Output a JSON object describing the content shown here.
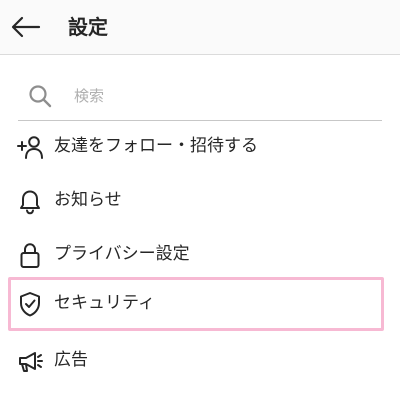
{
  "header": {
    "title": "設定",
    "back_icon": "arrow-left-icon"
  },
  "search": {
    "placeholder": "検索",
    "value": "",
    "icon": "search-icon"
  },
  "menu": [
    {
      "label": "友達をフォロー・招待する",
      "icon": "add-person-icon",
      "selected": false
    },
    {
      "label": "お知らせ",
      "icon": "bell-icon",
      "selected": false
    },
    {
      "label": "プライバシー設定",
      "icon": "lock-icon",
      "selected": false
    },
    {
      "label": "セキュリティ",
      "icon": "shield-check-icon",
      "selected": true
    },
    {
      "label": "広告",
      "icon": "megaphone-icon",
      "selected": false
    }
  ],
  "colors": {
    "highlight": "#f7b9d3",
    "header_bg": "#fafafa",
    "text": "#262626",
    "placeholder": "#b0b0b0"
  }
}
